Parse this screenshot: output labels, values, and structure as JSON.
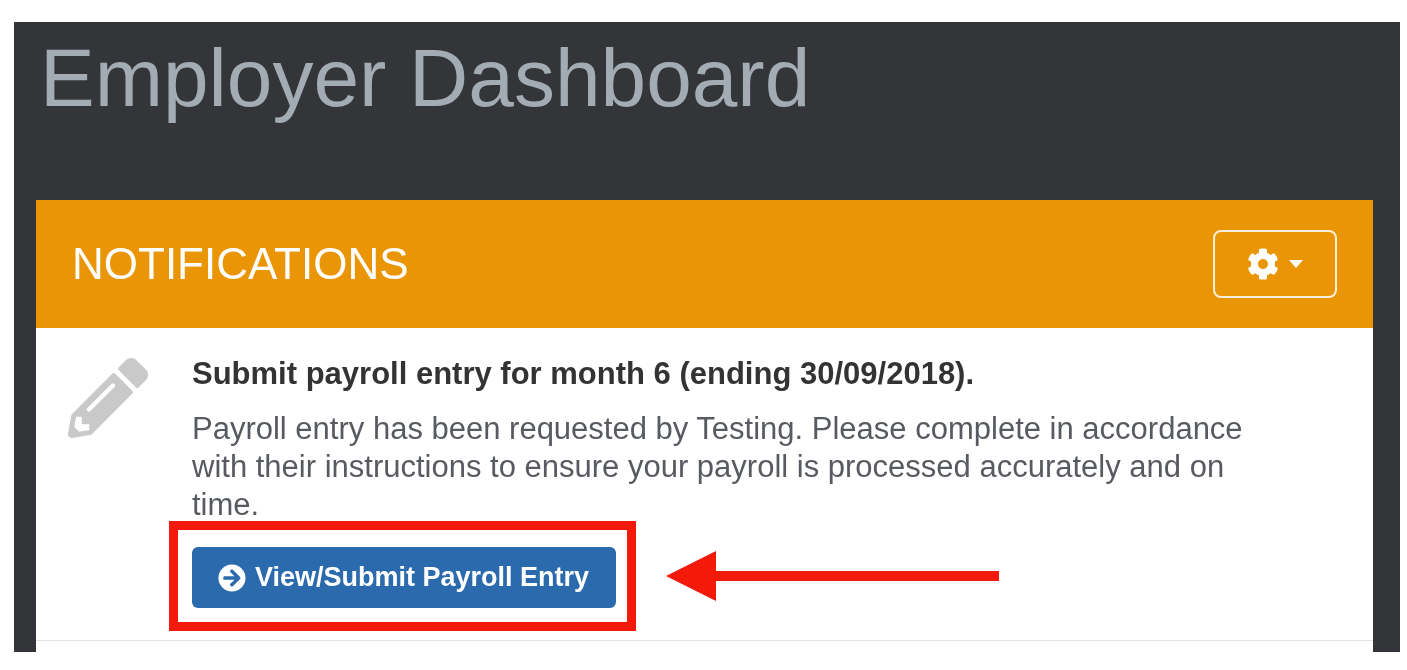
{
  "page": {
    "title": "Employer Dashboard"
  },
  "notifications_panel": {
    "title": "NOTIFICATIONS"
  },
  "notifications": [
    {
      "kind": "payroll",
      "title": "Submit payroll entry for month 6 (ending 30/09/2018).",
      "message": "Payroll entry has been requested by Testing. Please complete in accordance with their instructions to ensure your payroll is processed accurately and on time.",
      "action": {
        "label": "View/Submit Payroll Entry",
        "highlighted": true
      }
    }
  ]
}
